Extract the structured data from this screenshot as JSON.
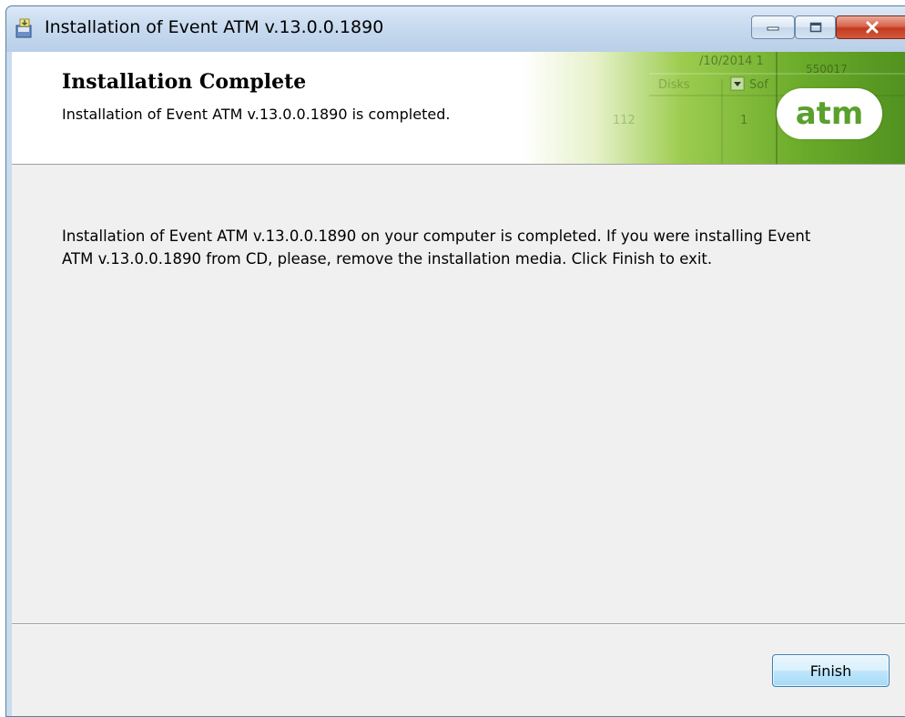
{
  "window": {
    "title": "Installation of Event ATM v.13.0.0.1890",
    "icon": "installer-icon",
    "controls": [
      "minimize-icon",
      "maximize-icon",
      "close-icon"
    ]
  },
  "banner": {
    "title": "Installation Complete",
    "subtitle": "Installation of Event ATM v.13.0.0.1890 is completed.",
    "logo_text": "atm",
    "art_labels": [
      "/10/2014 1",
      "550017",
      "Disks",
      "Sof",
      "112",
      "1"
    ]
  },
  "main": {
    "message": "Installation of Event ATM v.13.0.0.1890 on your computer is completed. If you were installing Event ATM v.13.0.0.1890 from CD, please, remove the installation media. Click Finish to exit."
  },
  "footer": {
    "finish_label": "Finish"
  },
  "colors": {
    "brand_green": "#5aa02c",
    "dialog_bg": "#f0f0f0",
    "title_bar": "#c6d9ee",
    "close_red": "#c23a1f"
  }
}
